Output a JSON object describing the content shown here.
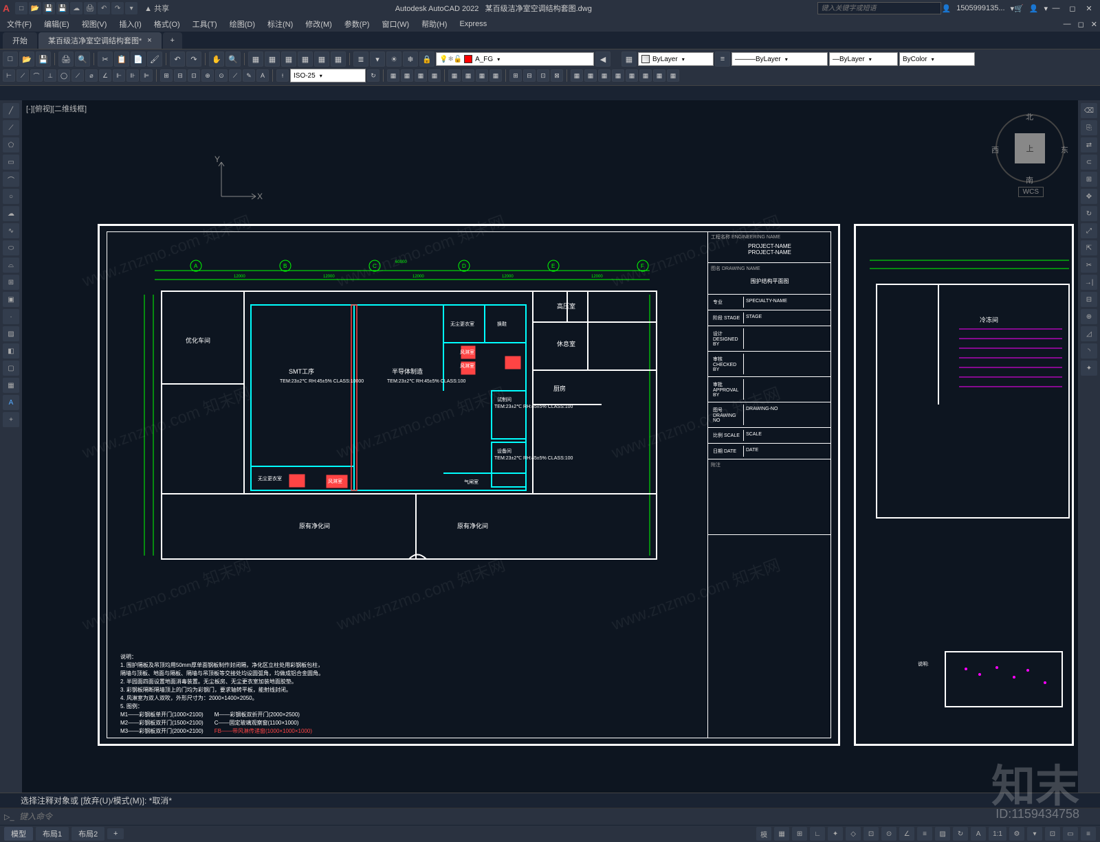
{
  "app": {
    "name": "Autodesk AutoCAD 2022",
    "filename": "某百级洁净室空调结构套图.dwg",
    "search_placeholder": "键入关键字或短语",
    "user": "1505999135...",
    "share": "共享"
  },
  "menu": [
    "文件(F)",
    "编辑(E)",
    "视图(V)",
    "插入(I)",
    "格式(O)",
    "工具(T)",
    "绘图(D)",
    "标注(N)",
    "修改(M)",
    "参数(P)",
    "窗口(W)",
    "帮助(H)",
    "Express"
  ],
  "tabs": {
    "start": "开始",
    "doc": "某百级洁净室空调结构套图*"
  },
  "props": {
    "layer": "A_FG",
    "linetype": "ByLayer",
    "lineweight": "ByLayer",
    "plotstyle": "ByLayer",
    "color": "ByColor",
    "dimstyle": "ISO-25"
  },
  "canvas": {
    "viewlabel": "[-][俯视][二维线框]",
    "cube_top": "上",
    "cube_n": "北",
    "cube_s": "南",
    "cube_e": "东",
    "cube_w": "西",
    "wcs": "WCS",
    "ucs_x": "X",
    "ucs_y": "Y"
  },
  "titleblock": {
    "eng_label": "工程名称\nENGINEERING NAME",
    "project1": "PROJECT-NAME",
    "project2": "PROJECT-NAME",
    "drw_label": "图名\nDRAWING NAME",
    "drw_name": "围护结构平面图",
    "rows": [
      {
        "l": "专业",
        "r": "SPECIALTY-NAME"
      },
      {
        "l": "阶段\nSTAGE",
        "r": "STAGE"
      },
      {
        "l": "设计\nDESIGNED BY",
        "r": ""
      },
      {
        "l": "审核\nCHECKED BY",
        "r": ""
      },
      {
        "l": "审批\nAPPROVAL BY",
        "r": ""
      },
      {
        "l": "图号\nDRAWING NO",
        "r": "DRAWING-NO"
      },
      {
        "l": "比例\nSCALE",
        "r": "SCALE"
      },
      {
        "l": "日期\nDATE",
        "r": "DATE"
      }
    ],
    "note_h": "附注"
  },
  "rooms": {
    "r1": "优化车间",
    "r2": "SMT工序",
    "r2s": "TEM:23±2℃\nRH:45±5%\nCLASS:10000",
    "r3": "半导体制造",
    "r3s": "TEM:23±2℃\nRH:45±5%\nCLASS:100",
    "r4": "无尘更衣室",
    "r5": "换鞋",
    "r6": "风淋室",
    "r7": "高压室",
    "r8": "休息室",
    "r9": "厨房",
    "r10": "试制间",
    "r10s": "TEM:23±2℃\nRH:45±5%\nCLASS:100",
    "r11": "设备间",
    "r11s": "TEM:23±2℃\nRH:45±5%\nCLASS:100",
    "r12": "气闸室",
    "r13": "无尘更衣室",
    "r14": "风淋室",
    "r15": "原有净化间",
    "r16": "原有净化间",
    "r17": "冷冻间",
    "n1": "说明:",
    "grids": [
      "A",
      "B",
      "C",
      "D",
      "E",
      "F"
    ],
    "dims_top": [
      "12000",
      "12000",
      "12000",
      "12000",
      "12000"
    ],
    "dim_total": "60000"
  },
  "notes": {
    "h": "说明：",
    "l1": "1. 围护隔板及吊顶均用50mm厚单面钢板制作封闭隔，净化区立柱处用彩钢板包柱，",
    "l1b": "   隔墙与顶板、地面与隔板、隔墙与吊顶板等交接处均设圆弧角，均做成铝合金圆角。",
    "l2": "2. 半园面四面设置地面消毒装置。无尘板房、无尘更衣室加装地面胶垫。",
    "l3": "3. 彩钢板隔断隔墙顶上的门均为彩钢门，要求轴转平板，能射线封闭。",
    "l4": "4. 风淋室为双人双吹，外形尺寸为：2000×1400×2050。",
    "l5": "5. 图例：",
    "leg": [
      {
        "a": "M1——彩钢板单开门(1000×2100)",
        "b": "M——彩钢板双折开门(2000×2500)"
      },
      {
        "a": "M2——彩钢板双开门(1500×2100)",
        "b": "C——固定玻璃观察窗(1100×1000)"
      },
      {
        "a": "M3——彩钢板双开门(2000×2100)",
        "b": "FB——带风淋传递窗(1000×1000×1000)"
      }
    ]
  },
  "cmd": {
    "history": "选择注释对象或 [放弃(U)/模式(M)]: *取消*",
    "placeholder": "键入命令"
  },
  "status": {
    "tabs": [
      "模型",
      "布局1",
      "布局2"
    ],
    "scale": "1:1"
  },
  "watermark": {
    "text": "www.znzmo.com 知末网",
    "big": "知末",
    "id": "ID:1159434758"
  }
}
